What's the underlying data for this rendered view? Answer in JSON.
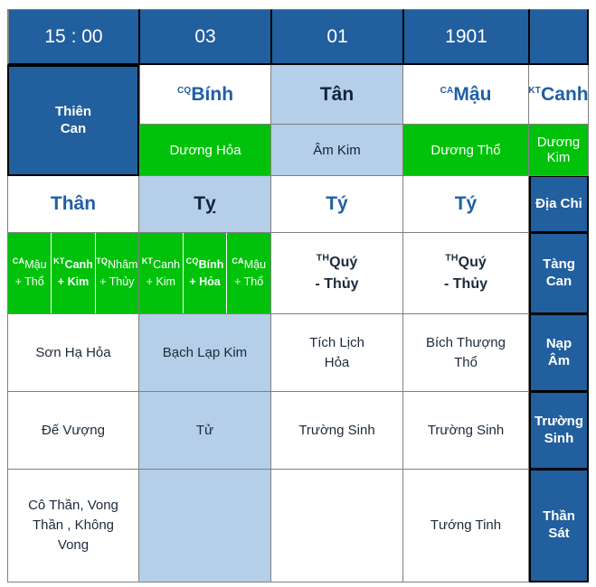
{
  "table": {
    "header": {
      "columns": [
        "15 : 00",
        "03",
        "01",
        "1901",
        ""
      ]
    },
    "row_labels": {
      "thien_can": "Thiên\nCan",
      "thien_can_l1": "Thiên",
      "thien_can_l2": "Can",
      "dia_chi": "Địa Chi",
      "tang_can_l1": "Tàng",
      "tang_can_l2": "Can",
      "nap_am_l1": "Nạp",
      "nap_am_l2": "Âm",
      "truong_sinh_l1": "Trường",
      "truong_sinh_l2": "Sinh",
      "than_sat_l1": "Thần",
      "than_sat_l2": "Sát"
    },
    "thien_can": {
      "values": [
        {
          "sup": "CQ",
          "name": "Bính"
        },
        {
          "sup": "",
          "name": "Tân"
        },
        {
          "sup": "CA",
          "name": "Mậu"
        },
        {
          "sup": "KT",
          "name": "Canh"
        }
      ]
    },
    "thien_can_element": {
      "values": [
        "Dương Hỏa",
        "Âm Kim",
        "Dương Thổ",
        "Dương Kim"
      ]
    },
    "dia_chi": {
      "values": [
        "Thân",
        "Tỵ",
        "Tý",
        "Tý"
      ]
    },
    "tang_can": {
      "col1": [
        {
          "sup": "CA",
          "name": "Mậu",
          "elem": "+ Thổ",
          "strong": false
        },
        {
          "sup": "KT",
          "name": "Canh",
          "elem": "+ Kim",
          "strong": true
        },
        {
          "sup": "TQ",
          "name": "Nhâm",
          "elem": "+ Thủy",
          "strong": false
        }
      ],
      "col2": [
        {
          "sup": "KT",
          "name": "Canh",
          "elem": "+ Kim",
          "strong": false
        },
        {
          "sup": "CQ",
          "name": "Bính",
          "elem": "+ Hỏa",
          "strong": true
        },
        {
          "sup": "CA",
          "name": "Mậu",
          "elem": "+ Thổ",
          "strong": false
        }
      ],
      "col3": [
        {
          "sup": "TH",
          "name": "Quý",
          "elem": "- Thủy",
          "strong": false
        }
      ],
      "col4": [
        {
          "sup": "TH",
          "name": "Quý",
          "elem": "- Thủy",
          "strong": false
        }
      ]
    },
    "nap_am": {
      "values": [
        "Sơn Hạ Hỏa",
        "Bạch Lạp Kim",
        "Tích Lịch\nHỏa",
        "Bích Thượng\nThổ"
      ],
      "col3_l1": "Tích Lịch",
      "col3_l2": "Hỏa",
      "col4_l1": "Bích Thượng",
      "col4_l2": "Thổ"
    },
    "truong_sinh": {
      "values": [
        "Đế Vượng",
        "Tử",
        "Trường Sinh",
        "Trường Sinh"
      ]
    },
    "than_sat": {
      "col1_l1": "Cô Thần, Vong",
      "col1_l2": "Thần , Không",
      "col1_l3": "Vong",
      "col2": "",
      "col3": "",
      "col4": "Tướng Tinh"
    }
  },
  "colors": {
    "header_blue": "#215F9E",
    "light_blue": "#B4CFE7",
    "green": "#00C20A",
    "stem_blue": "#1F5FA8",
    "border_gray": "#808080",
    "border_black": "#000000"
  }
}
